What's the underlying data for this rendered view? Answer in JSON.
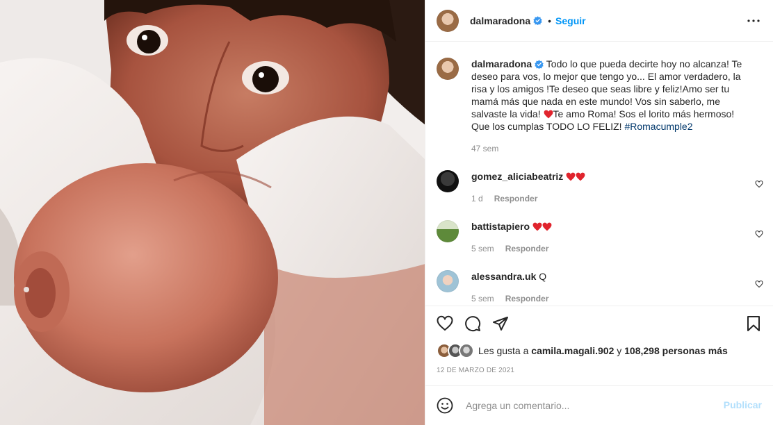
{
  "post": {
    "username": "dalmaradona",
    "follow_label": "Seguir",
    "separator": "•",
    "caption": "Todo lo que pueda decirte hoy no alcanza! Te deseo para vos, lo mejor que tengo yo... El amor verdadero, la risa y los amigos !Te deseo que seas libre y feliz!Amo ser tu mamá más que nada en este mundo! Vos sin saberlo, me salvaste la vida! ",
    "caption_end": "Te amo Roma! Sos el lorito más hermoso! Que los cumplas TODO LO FELIZ! ",
    "hashtag": "#Romacumple2",
    "caption_time": "47 sem",
    "date": "12 DE MARZO DE 2021"
  },
  "comments": [
    {
      "username": "gomez_aliciabeatriz",
      "text": "",
      "time": "1 d",
      "reply_label": "Responder"
    },
    {
      "username": "battistapiero",
      "text": "",
      "time": "5 sem",
      "reply_label": "Responder"
    },
    {
      "username": "alessandra.uk",
      "text": "Q",
      "time": "5 sem",
      "reply_label": "Responder"
    }
  ],
  "likes": {
    "prefix": "Les gusta a",
    "user": "camila.magali.902",
    "connector": "y",
    "count": "108,298 personas más"
  },
  "add_comment": {
    "placeholder": "Agrega un comentario...",
    "publish_label": "Publicar"
  },
  "icons": {
    "verified": "verified-badge-icon",
    "more": "more-options-icon",
    "like": "heart-icon",
    "comment": "comment-icon",
    "share": "paper-plane-icon",
    "save": "bookmark-icon",
    "emoji": "emoji-icon"
  },
  "colors": {
    "accent": "#0095f6",
    "verified": "#3897f0",
    "heart_emoji": "#e0242d",
    "muted": "#8e8e8e",
    "publish_disabled": "#b2dffc"
  }
}
